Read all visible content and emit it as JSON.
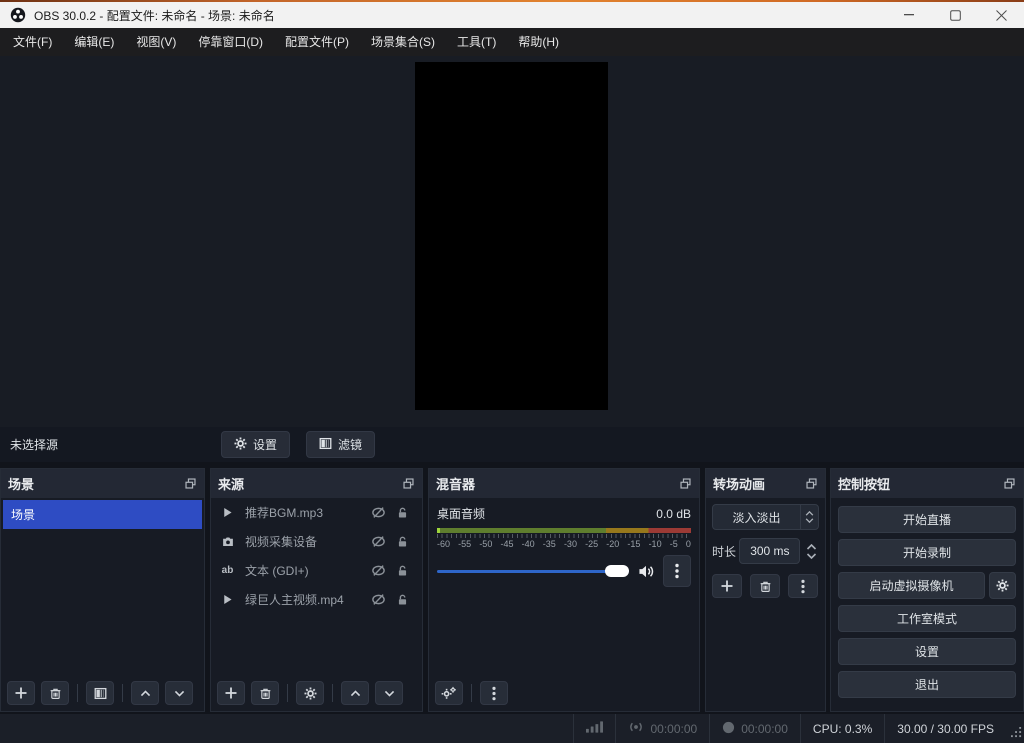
{
  "window": {
    "title": "OBS 30.0.2 - 配置文件: 未命名 - 场景: 未命名"
  },
  "menu": {
    "items": [
      "文件(F)",
      "编辑(E)",
      "视图(V)",
      "停靠窗口(D)",
      "配置文件(P)",
      "场景集合(S)",
      "工具(T)",
      "帮助(H)"
    ]
  },
  "source_toolbar": {
    "no_source_label": "未选择源",
    "properties_label": "设置",
    "filters_label": "滤镜"
  },
  "scenes": {
    "title": "场景",
    "items": [
      {
        "name": "场景",
        "selected": true
      }
    ]
  },
  "sources": {
    "title": "来源",
    "text_icon_glyph": "ab",
    "items": [
      {
        "icon": "media-icon",
        "name": "推荐BGM.mp3",
        "hidden": true,
        "locked": false
      },
      {
        "icon": "camera-icon",
        "name": "视频采集设备",
        "hidden": true,
        "locked": false
      },
      {
        "icon": "text-icon",
        "name": "文本 (GDI+)",
        "hidden": true,
        "locked": false
      },
      {
        "icon": "media-icon",
        "name": "绿巨人主视频.mp4",
        "hidden": true,
        "locked": false
      }
    ]
  },
  "mixer": {
    "title": "混音器",
    "channel": {
      "name": "桌面音频",
      "level": "0.0 dB",
      "ticks": [
        "-60",
        "-55",
        "-50",
        "-45",
        "-40",
        "-35",
        "-30",
        "-25",
        "-20",
        "-15",
        "-10",
        "-5",
        "0"
      ],
      "volume_percent": 100
    }
  },
  "transitions": {
    "title": "转场动画",
    "transition": "淡入淡出",
    "duration_label": "时长",
    "duration_value": "300 ms"
  },
  "controls": {
    "title": "控制按钮",
    "buttons": [
      "开始直播",
      "开始录制",
      "启动虚拟摄像机",
      "工作室模式",
      "设置",
      "退出"
    ]
  },
  "statusbar": {
    "stream_time": "00:00:00",
    "record_time": "00:00:00",
    "cpu": "CPU: 0.3%",
    "fps": "30.00 / 30.00 FPS"
  },
  "colors": {
    "selection_blue": "#2e4cc3",
    "slider_blue": "#2e66c9",
    "meter_green": "#5f7e2e",
    "meter_yellow": "#97781c",
    "meter_red": "#9c3a35",
    "titlebar_bg": "#f2f2f2",
    "menubar_bg": "#1d1d1f",
    "panel_bg": "#171b24",
    "panel_header_bg": "#232834",
    "button_bg": "#272d38"
  }
}
